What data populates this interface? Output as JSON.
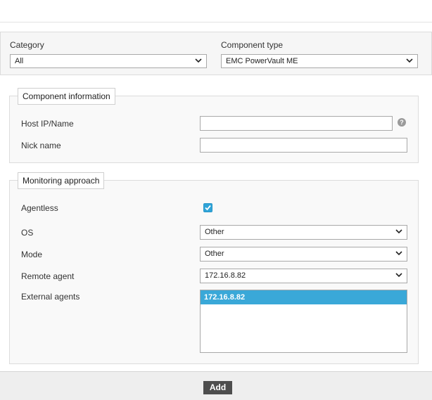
{
  "filters": {
    "category_label": "Category",
    "category_value": "All",
    "component_type_label": "Component type",
    "component_type_value": "EMC PowerVault ME"
  },
  "component_information": {
    "legend": "Component information",
    "host_label": "Host IP/Name",
    "host_value": "",
    "help_glyph": "?",
    "nick_label": "Nick name",
    "nick_value": ""
  },
  "monitoring_approach": {
    "legend": "Monitoring approach",
    "agentless_label": "Agentless",
    "agentless_checked": true,
    "os_label": "OS",
    "os_value": "Other",
    "mode_label": "Mode",
    "mode_value": "Other",
    "remote_agent_label": "Remote agent",
    "remote_agent_value": "172.16.8.82",
    "external_agents_label": "External agents",
    "external_agents": [
      "172.16.8.82"
    ]
  },
  "footer": {
    "add_label": "Add"
  },
  "colors": {
    "accent": "#3aa8d8",
    "button_bg": "#4d4d4d"
  },
  "icons": {
    "dropdown": "chevron-down-icon",
    "help": "question-icon",
    "check": "check-icon"
  }
}
